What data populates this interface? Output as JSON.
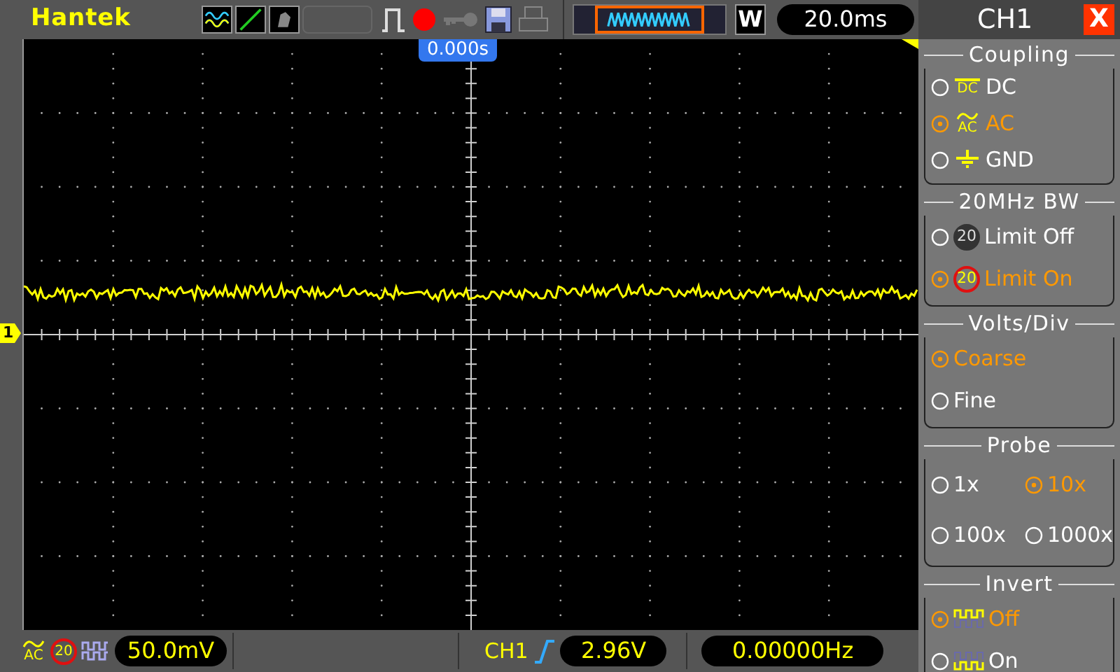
{
  "header": {
    "brand": "Hantek",
    "time_position": "0.000s",
    "zoom_label": "W",
    "timebase": "20.0ms"
  },
  "channel_marker": "1",
  "side_panel": {
    "title": "CH1",
    "close": "X",
    "sections": [
      {
        "title": "Coupling",
        "options": [
          {
            "kind": "dc",
            "icon_text": "DC",
            "label": "DC",
            "selected": false
          },
          {
            "kind": "ac",
            "icon_text": "AC",
            "label": "AC",
            "selected": true
          },
          {
            "kind": "gnd",
            "label": "GND",
            "selected": false
          }
        ]
      },
      {
        "title": "20MHz BW",
        "options": [
          {
            "kind": "bw",
            "icon_text": "20",
            "label": "Limit Off",
            "selected": false
          },
          {
            "kind": "bw",
            "icon_text": "20",
            "label": "Limit On",
            "selected": true
          }
        ]
      },
      {
        "title": "Volts/Div",
        "options": [
          {
            "kind": "plain",
            "label": "Coarse",
            "selected": true
          },
          {
            "kind": "plain",
            "label": "Fine",
            "selected": false
          }
        ]
      },
      {
        "title": "Probe",
        "options": [
          {
            "kind": "plain",
            "label": "1x",
            "selected": false
          },
          {
            "kind": "plain",
            "label": "10x",
            "selected": true
          },
          {
            "kind": "plain",
            "label": "100x",
            "selected": false
          },
          {
            "kind": "plain",
            "label": "1000x",
            "selected": false
          }
        ]
      },
      {
        "title": "Invert",
        "options": [
          {
            "kind": "normal",
            "label": "Off",
            "selected": true
          },
          {
            "kind": "inverted",
            "label": "On",
            "selected": false
          }
        ]
      }
    ]
  },
  "status_bar": {
    "coupling": "AC",
    "bandwidth": "20",
    "volts_div": "50.0mV",
    "trigger_source": "CH1",
    "trigger_level": "2.96V",
    "frequency": "0.00000Hz"
  }
}
